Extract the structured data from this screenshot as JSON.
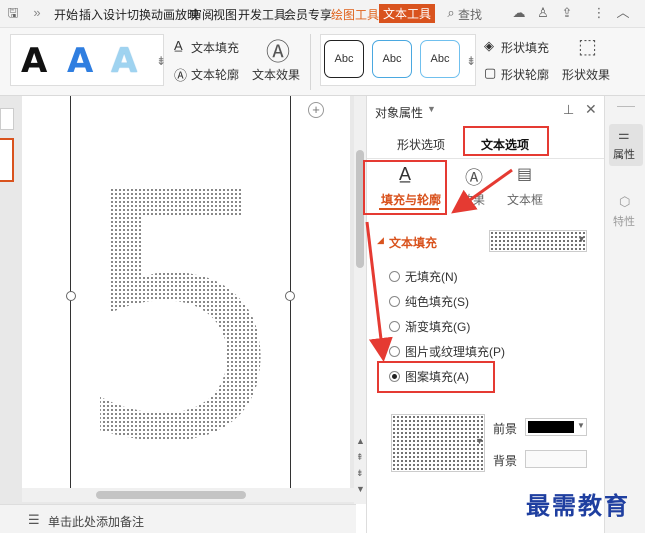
{
  "menubar": {
    "items": [
      "开始",
      "插入",
      "设计",
      "切换",
      "动画",
      "放映",
      "审阅",
      "视图",
      "开发工具",
      "会员专享",
      "绘图工具",
      "文本工具"
    ],
    "search_label": "查找"
  },
  "ribbon": {
    "text_fill": "文本填充",
    "text_outline": "文本轮廓",
    "text_effect": "文本效果",
    "shape_fill": "形状填充",
    "shape_outline": "形状轮廓",
    "shape_effect": "形状效果",
    "abc_labels": [
      "Abc",
      "Abc",
      "Abc"
    ],
    "big_a": [
      "A",
      "A",
      "A"
    ]
  },
  "panel": {
    "title": "对象属性",
    "tabs": [
      "形状选项",
      "文本选项"
    ],
    "subtabs": [
      "填充与轮廓",
      "效果",
      "文本框"
    ],
    "section_title": "文本填充",
    "radio_options": [
      "无填充(N)",
      "纯色填充(S)",
      "渐变填充(G)",
      "图片或纹理填充(P)",
      "图案填充(A)"
    ],
    "selected_option": "图案填充(A)",
    "foreground_label": "前景",
    "background_label": "背景"
  },
  "sidebar_right": {
    "items": [
      "属性",
      "特性"
    ]
  },
  "slide": {
    "number_text": "5"
  },
  "status": {
    "notes_placeholder": "单击此处添加备注"
  },
  "watermark": "最需教育",
  "colors": {
    "accent_orange": "#d9531e",
    "highlight_red": "#e53a32",
    "foreground_swatch": "#000000"
  }
}
